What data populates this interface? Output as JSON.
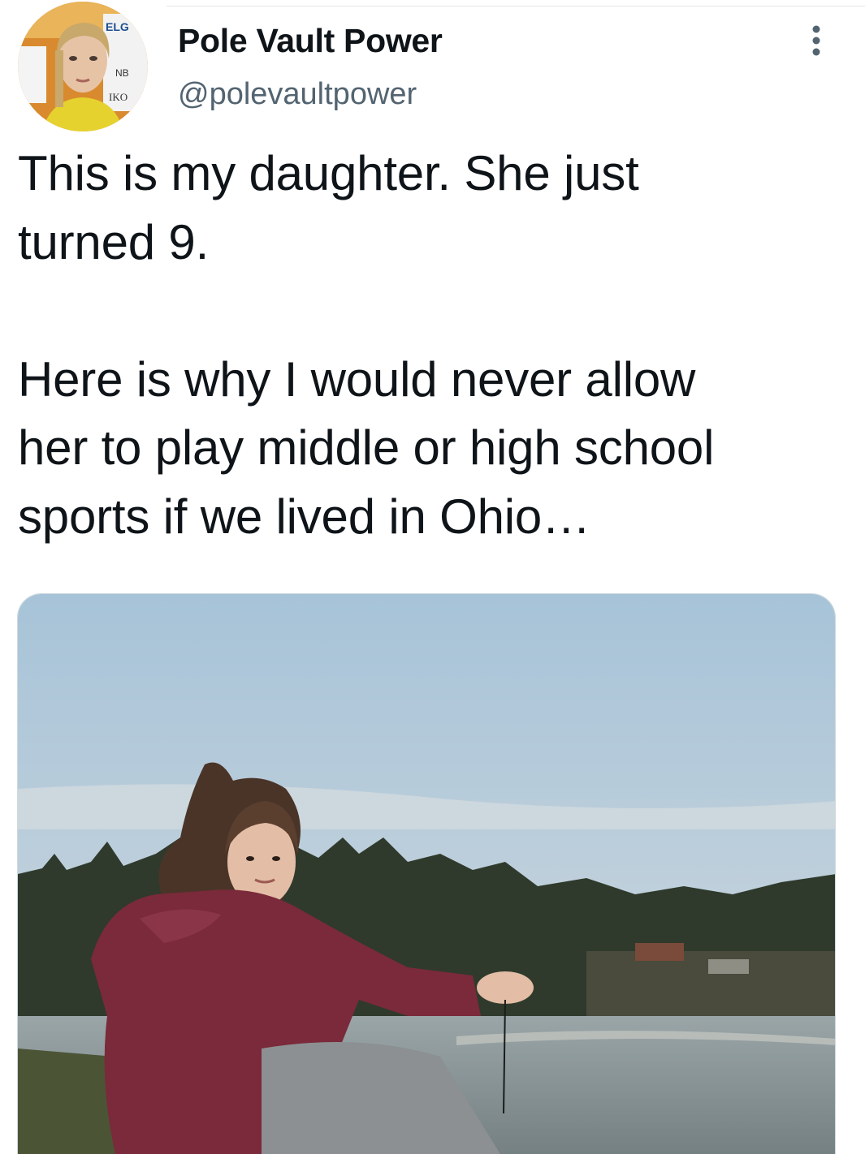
{
  "author": {
    "display_name": "Pole Vault Power",
    "handle": "@polevaultpower",
    "avatar_icon": "profile-photo-icon"
  },
  "menu": {
    "icon": "more-options-icon"
  },
  "tweet": {
    "paragraph_1": [
      "This is my daughter. She just",
      "turned 9."
    ],
    "paragraph_2": [
      "Here is why I would never allow",
      "her to play middle or high school",
      "sports if we lived in Ohio…"
    ]
  },
  "media": {
    "kind": "photo",
    "icon": "attached-photo-icon"
  },
  "colors": {
    "text": "#0f1419",
    "handle": "#536471",
    "divider": "#e6e6e6",
    "sky": "#a9c2d6",
    "jacket": "#7a2a3a"
  }
}
